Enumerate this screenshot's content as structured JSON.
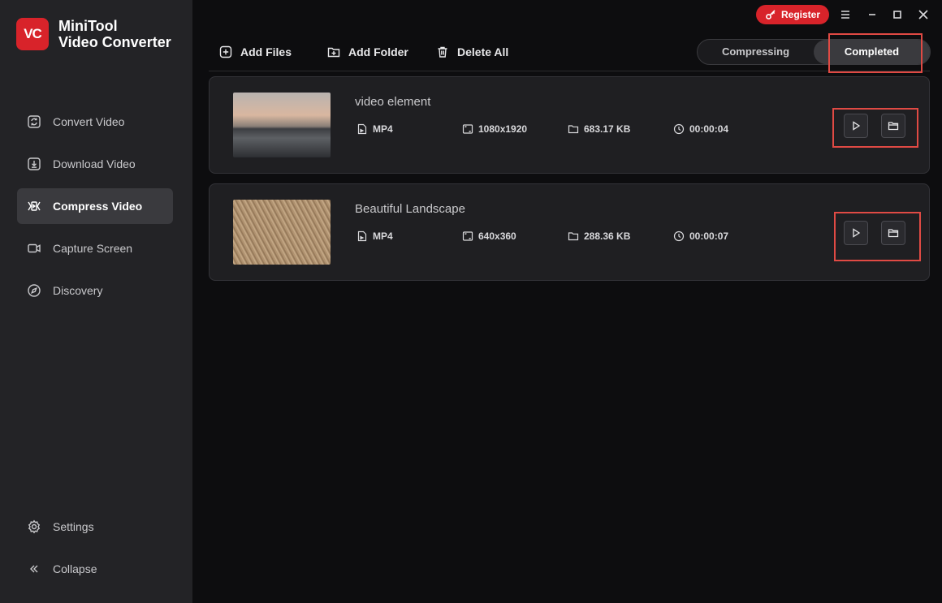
{
  "app": {
    "logo_mark": "VC",
    "title_line1": "MiniTool",
    "title_line2": "Video Converter"
  },
  "topbar": {
    "register_label": "Register"
  },
  "sidebar": {
    "items": [
      {
        "label": "Convert Video",
        "icon": "convert-icon"
      },
      {
        "label": "Download Video",
        "icon": "download-icon"
      },
      {
        "label": "Compress Video",
        "icon": "compress-icon",
        "active": true
      },
      {
        "label": "Capture Screen",
        "icon": "camera-icon"
      },
      {
        "label": "Discovery",
        "icon": "compass-icon"
      }
    ],
    "bottom": [
      {
        "label": "Settings",
        "icon": "gear-icon"
      },
      {
        "label": "Collapse",
        "icon": "collapse-icon"
      }
    ]
  },
  "toolbar": {
    "add_files": "Add Files",
    "add_folder": "Add Folder",
    "delete_all": "Delete All"
  },
  "tabs": {
    "compressing": "Compressing",
    "completed": "Completed",
    "selected": "Completed"
  },
  "files": [
    {
      "name": "video element",
      "format": "MP4",
      "resolution": "1080x1920",
      "size": "683.17 KB",
      "duration": "00:00:04"
    },
    {
      "name": "Beautiful Landscape",
      "format": "MP4",
      "resolution": "640x360",
      "size": "288.36 KB",
      "duration": "00:00:07"
    }
  ],
  "colors": {
    "accent": "#d8232a",
    "highlight": "#e04a44",
    "sidebar_bg": "#232326",
    "main_bg": "#0d0d0f"
  }
}
